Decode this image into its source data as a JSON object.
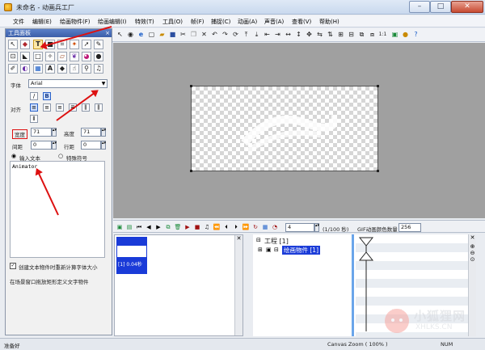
{
  "window": {
    "title": "未命名 - 动画兵工厂",
    "min": "–",
    "max": "□",
    "close": "✕"
  },
  "menu": [
    "文件",
    "编辑(E)",
    "绘画物件(F)",
    "绘画编辑(I)",
    "特效(T)",
    "工具(O)",
    "帧(F)",
    "捕捉(C)",
    "动画(A)",
    "声音(A)",
    "查看(V)",
    "帮助(H)"
  ],
  "left_panel": {
    "title": "工具面板",
    "font_label": "字体",
    "font_value": "Arial",
    "align_label": "对齐",
    "width_label": "宽度",
    "width_value": "71",
    "height_label": "高度",
    "height_value": "71",
    "spacing_label": "间距",
    "spacing_value": "0",
    "line_spacing_label": "行距",
    "line_spacing_value": "0",
    "radio_input_text": "输入文本",
    "radio_special_symbol": "特殊符号",
    "text_value": "Animator",
    "checkbox_label": "创建文本物件时重新计算字体大小",
    "hint": "在场景窗口拖放矩形定义文字物件"
  },
  "timeline": {
    "frame_value": "4",
    "frame_unit": "(1/100 秒)",
    "gif_label": "GIF动画颜色数量",
    "gif_value": "256",
    "thumb_label": "[1] 0.04秒",
    "tree_root": "工程 [1]",
    "tree_child": "绘画物件 [1]"
  },
  "status": {
    "left": "准备好",
    "zoom": "Canvas Zoom ( 100% )",
    "num": "NUM"
  },
  "watermark": {
    "line1": "小狐狸网",
    "line2": "XHLKS.CN"
  },
  "colors": {
    "accent": "#3b5ea8",
    "arrow": "#dd1111",
    "stage": "#a0a0a0"
  }
}
